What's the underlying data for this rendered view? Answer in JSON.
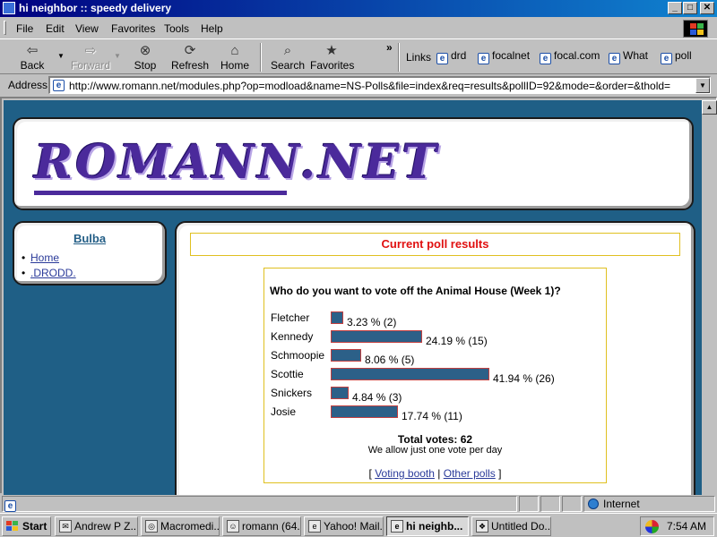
{
  "window": {
    "title": "hi neighbor :: speedy delivery",
    "controls": {
      "minimize": "_",
      "maximize": "□",
      "close": "✕"
    }
  },
  "menu": [
    "File",
    "Edit",
    "View",
    "Favorites",
    "Tools",
    "Help"
  ],
  "toolbar": {
    "back": "Back",
    "forward": "Forward",
    "stop": "Stop",
    "refresh": "Refresh",
    "home": "Home",
    "search": "Search",
    "favorites": "Favorites",
    "more": "»"
  },
  "links": {
    "label": "Links",
    "items": [
      "drd",
      "focalnet",
      "focal.com",
      "What",
      "poll"
    ]
  },
  "address": {
    "label": "Address",
    "url": "http://www.romann.net/modules.php?op=modload&name=NS-Polls&file=index&req=results&pollID=92&mode=&order=&thold="
  },
  "site": {
    "logo": "ROMANN.NET",
    "sidebar": {
      "title": "Bulba",
      "items": [
        "Home",
        ".DRODD."
      ]
    }
  },
  "poll": {
    "heading": "Current poll results",
    "question": "Who do you want to vote off the Animal House (Week 1)?",
    "options": [
      {
        "name": "Fletcher",
        "percent": 3.23,
        "label": "3.23 % (2)"
      },
      {
        "name": "Kennedy",
        "percent": 24.19,
        "label": "24.19 % (15)"
      },
      {
        "name": "Schmoopie",
        "percent": 8.06,
        "label": "8.06 % (5)"
      },
      {
        "name": "Scottie",
        "percent": 41.94,
        "label": "41.94 % (26)"
      },
      {
        "name": "Snickers",
        "percent": 4.84,
        "label": "4.84 % (3)"
      },
      {
        "name": "Josie",
        "percent": 17.74,
        "label": "17.74 % (11)"
      }
    ],
    "total": "Total votes: 62",
    "note": "We allow just one vote per day",
    "links": {
      "open": "[",
      "voting_booth": "Voting booth",
      "divider": "|",
      "other_polls": "Other polls",
      "close": "]"
    },
    "bar_color": "#2c6088"
  },
  "status": {
    "zone": "Internet"
  },
  "taskbar": {
    "start": "Start",
    "tasks": [
      {
        "label": "Andrew P Z...",
        "active": false
      },
      {
        "label": "Macromedi...",
        "active": false
      },
      {
        "label": "romann (64...",
        "active": false
      },
      {
        "label": "Yahoo! Mail...",
        "active": false
      },
      {
        "label": "hi neighb...",
        "active": true
      },
      {
        "label": "Untitled Do...",
        "active": false
      }
    ],
    "clock": "7:54 AM"
  }
}
